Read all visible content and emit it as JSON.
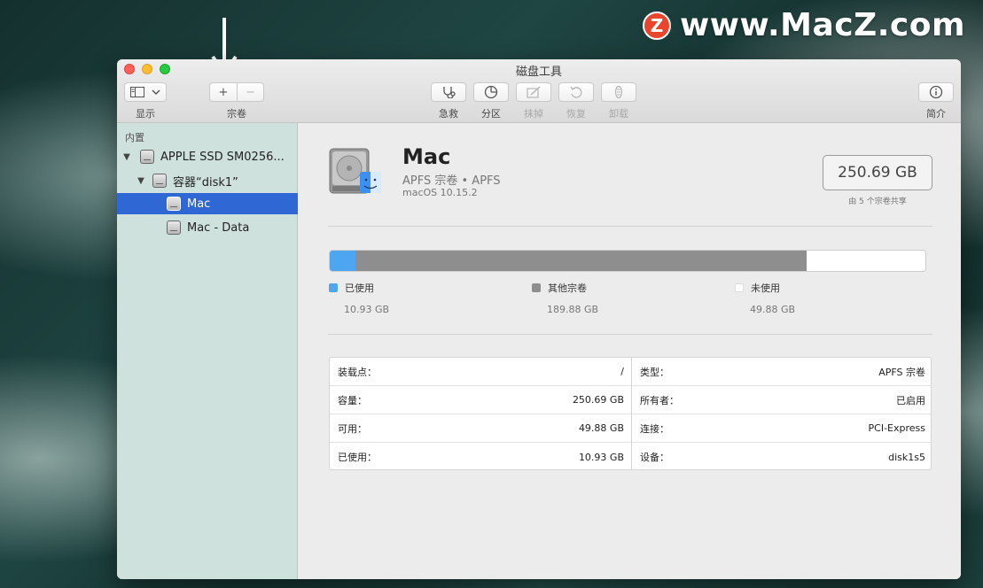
{
  "watermark": {
    "logo_letter": "Z",
    "text": "www.MacZ.com"
  },
  "window": {
    "title": "磁盘工具"
  },
  "toolbar": {
    "view_label": "显示",
    "volume_label": "宗卷",
    "add_symbol": "+",
    "remove_symbol": "−",
    "first_aid_label": "急救",
    "partition_label": "分区",
    "erase_label": "抹掉",
    "restore_label": "恢复",
    "unmount_label": "卸载",
    "info_label": "简介"
  },
  "sidebar": {
    "section": "内置",
    "items": [
      {
        "label": "APPLE SSD SM0256...",
        "level": 0,
        "expanded": true
      },
      {
        "label": "容器“disk1”",
        "level": 1,
        "expanded": true
      },
      {
        "label": "Mac",
        "level": 2,
        "selected": true
      },
      {
        "label": "Mac - Data",
        "level": 2
      }
    ]
  },
  "volume": {
    "name": "Mac",
    "subtitle": "APFS 宗卷 • APFS",
    "os": "macOS 10.15.2",
    "capacity": "250.69 GB",
    "capacity_note": "由 5 个宗卷共享"
  },
  "usage": {
    "used_fraction": 0.0436,
    "other_fraction": 0.7573,
    "free_fraction": 0.1991,
    "used": {
      "label": "已使用",
      "value": "10.93 GB",
      "color": "#4ea6f0"
    },
    "other": {
      "label": "其他宗卷",
      "value": "189.88 GB",
      "color": "#8e8e8e"
    },
    "free": {
      "label": "未使用",
      "value": "49.88 GB",
      "color": "#ffffff"
    }
  },
  "info": {
    "left": [
      {
        "label": "装载点：",
        "value": "/"
      },
      {
        "label": "容量：",
        "value": "250.69 GB"
      },
      {
        "label": "可用：",
        "value": "49.88 GB"
      },
      {
        "label": "已使用：",
        "value": "10.93 GB"
      }
    ],
    "right": [
      {
        "label": "类型：",
        "value": "APFS 宗卷"
      },
      {
        "label": "所有者：",
        "value": "已启用"
      },
      {
        "label": "连接：",
        "value": "PCI-Express"
      },
      {
        "label": "设备：",
        "value": "disk1s5"
      }
    ]
  }
}
